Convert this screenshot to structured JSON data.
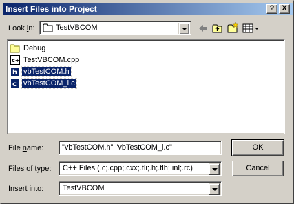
{
  "window": {
    "title": "Insert Files into Project",
    "help_label": "?",
    "close_label": "X"
  },
  "lookin": {
    "label_prefix": "Look ",
    "label_hotkey": "i",
    "label_suffix": "n:",
    "value": "TestVBCOM",
    "icon": "folder-icon"
  },
  "toolbar": {
    "back_icon": "back-arrow-icon",
    "up_icon": "up-folder-icon",
    "new_folder_icon": "new-folder-icon",
    "view_icon": "view-menu-icon"
  },
  "files": [
    {
      "name": "Debug",
      "icon": "folder-icon",
      "selected": false
    },
    {
      "name": "TestVBCOM.cpp",
      "icon": "cpp-file-icon",
      "selected": false
    },
    {
      "name": "vbTestCOM.h",
      "icon": "header-file-icon",
      "selected": true
    },
    {
      "name": "vbTestCOM_i.c",
      "icon": "c-file-icon",
      "selected": true
    }
  ],
  "filename": {
    "label_prefix": "File ",
    "label_hotkey": "n",
    "label_suffix": "ame:",
    "value": "\"vbTestCOM.h\" \"vbTestCOM_i.c\""
  },
  "filetype": {
    "label_prefix": "Files of ",
    "label_hotkey": "t",
    "label_suffix": "ype:",
    "value": "C++ Files (.c;.cpp;.cxx;.tli;.h;.tlh;.inl;.rc)"
  },
  "insertinto": {
    "label_prefix": "Insert into:",
    "value": "TestVBCOM"
  },
  "buttons": {
    "ok": "OK",
    "cancel": "Cancel"
  },
  "colors": {
    "title_start": "#0a246a",
    "title_end": "#a6caf0",
    "selection": "#0a246a",
    "face": "#d4d0c8"
  }
}
